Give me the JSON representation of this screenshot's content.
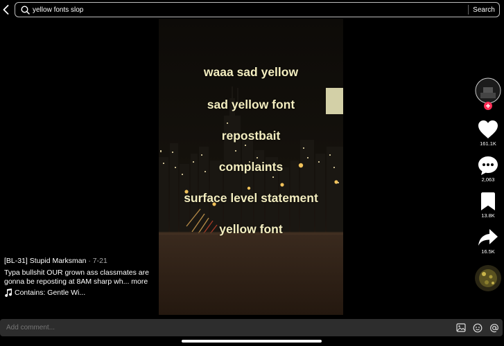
{
  "search": {
    "query": "yellow fonts slop",
    "button_label": "Search"
  },
  "video": {
    "overlay_lines": [
      "waaa sad yellow",
      "sad yellow font",
      "repostbait",
      "complaints",
      "surface level statement",
      "yellow font"
    ]
  },
  "actions": {
    "likes": "161.1K",
    "comments": "2,063",
    "saves": "13.8K",
    "shares": "16.5K"
  },
  "post": {
    "author": "[BL-31] Stupid Marksman",
    "date": " · 7-21",
    "caption": "Typa bullshit OUR grown ass classmates are gonna be reposting at 8AM sharp wh...",
    "more_label": "more",
    "sound": "Contains: Gentle Wi..."
  },
  "comment": {
    "placeholder": "Add comment..."
  },
  "colors": {
    "overlay_text": "#f4eec0",
    "follow_badge": "#fe2c55",
    "comment_bar": "#2d2d2d"
  }
}
